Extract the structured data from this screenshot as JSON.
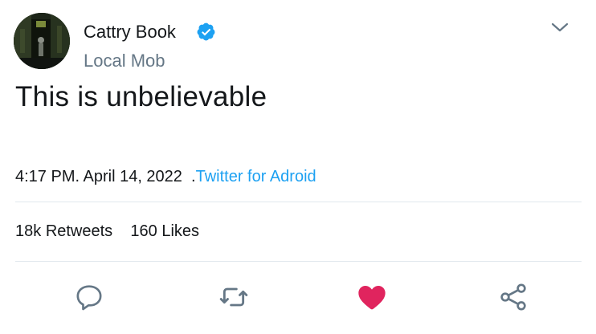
{
  "user": {
    "name": "Cattry Book",
    "handle": "Local Mob",
    "verified_icon": "verified-badge-icon",
    "avatar_icon": "avatar-image"
  },
  "tweet": {
    "text": "This is unbelievable",
    "time": "4:17 PM",
    "date": "April 14, 2022",
    "source": "Twitter for Adroid"
  },
  "stats": {
    "retweets_count": "18k",
    "retweets_label": "Retweets",
    "likes_count": "160",
    "likes_label": "Likes"
  },
  "actions": [
    "reply-icon",
    "retweet-icon",
    "like-icon",
    "share-icon"
  ],
  "colors": {
    "accent": "#1da1f2",
    "like": "#e0245e",
    "muted": "#657786",
    "divider": "#e1e8ed"
  }
}
